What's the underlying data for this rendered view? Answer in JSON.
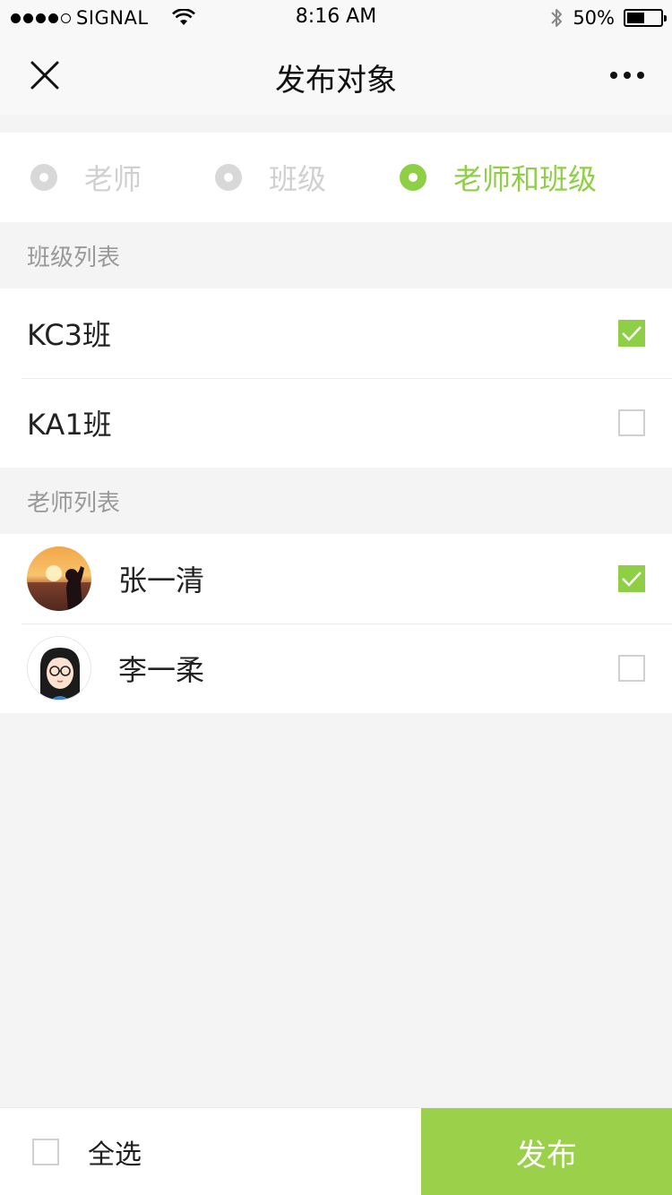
{
  "status_bar": {
    "carrier": "SIGNAL",
    "time": "8:16 AM",
    "battery": "50%",
    "battery_level": 0.5,
    "signal_bars": [
      true,
      true,
      true,
      true,
      false
    ]
  },
  "nav": {
    "title": "发布对象",
    "close_icon": "close-icon",
    "more_icon": "more-dots-icon"
  },
  "audience_options": [
    {
      "label": "老师",
      "selected": false
    },
    {
      "label": "班级",
      "selected": false
    },
    {
      "label": "老师和班级",
      "selected": true
    }
  ],
  "class_section": {
    "title": "班级列表",
    "items": [
      {
        "name": "KC3班",
        "checked": true
      },
      {
        "name": "KA1班",
        "checked": false
      }
    ]
  },
  "teacher_section": {
    "title": "老师列表",
    "items": [
      {
        "name": "张一清",
        "checked": true,
        "avatar": "sunset-photo-avatar"
      },
      {
        "name": "李一柔",
        "checked": false,
        "avatar": "cartoon-girl-avatar"
      }
    ]
  },
  "bottom_bar": {
    "select_all_label": "全选",
    "select_all_checked": false,
    "publish_label": "发布"
  },
  "colors": {
    "accent": "#8fcf46",
    "publish_button": "#9ad04a",
    "background": "#f4f4f4"
  }
}
